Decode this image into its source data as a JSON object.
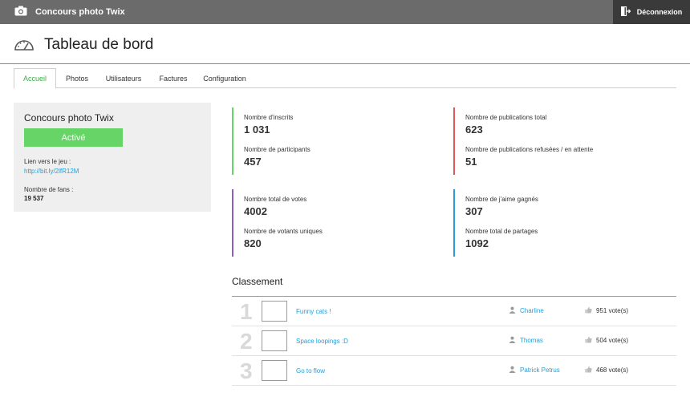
{
  "app": {
    "title": "Concours photo Twix",
    "logout_label": "Déconnexion"
  },
  "page": {
    "title": "Tableau de bord"
  },
  "tabs": [
    {
      "label": "Accueil",
      "active": true
    },
    {
      "label": "Photos"
    },
    {
      "label": "Utilisateurs"
    },
    {
      "label": "Factures"
    },
    {
      "label": "Configuration"
    }
  ],
  "contest": {
    "name": "Concours photo Twix",
    "status": "Activé",
    "link_label": "Lien vers le jeu :",
    "link": "http://bit.ly/2lfR12M",
    "fans_label": "Nombre de fans :",
    "fans": "19 537"
  },
  "stats": {
    "inscrits": {
      "label": "Nombre d'inscrits",
      "value": "1 031"
    },
    "participants": {
      "label": "Nombre de participants",
      "value": "457"
    },
    "publications": {
      "label": "Nombre de publications total",
      "value": "623"
    },
    "refusees": {
      "label": "Nombre de publications refusées / en attente",
      "value": "51"
    },
    "votes": {
      "label": "Nombre total de votes",
      "value": "4002"
    },
    "votants": {
      "label": "Nombre de votants uniques",
      "value": "820"
    },
    "jaime": {
      "label": "Nombre de j'aime gagnés",
      "value": "307"
    },
    "partages": {
      "label": "Nombre total de partages",
      "value": "1092"
    }
  },
  "colors": {
    "green": "#66d466",
    "red": "#e05555",
    "purple": "#8e5fc2",
    "blue": "#2e9ad6",
    "link": "#1ea0dc"
  },
  "ranking": {
    "title": "Classement",
    "rows": [
      {
        "rank": "1",
        "title": "Funny cats !",
        "user": "Charline",
        "votes": "951 vote(s)"
      },
      {
        "rank": "2",
        "title": "Space loopings :D",
        "user": "Thomas",
        "votes": "504 vote(s)"
      },
      {
        "rank": "3",
        "title": "Go to flow",
        "user": "Patrick Petrus",
        "votes": "468 vote(s)"
      }
    ]
  }
}
